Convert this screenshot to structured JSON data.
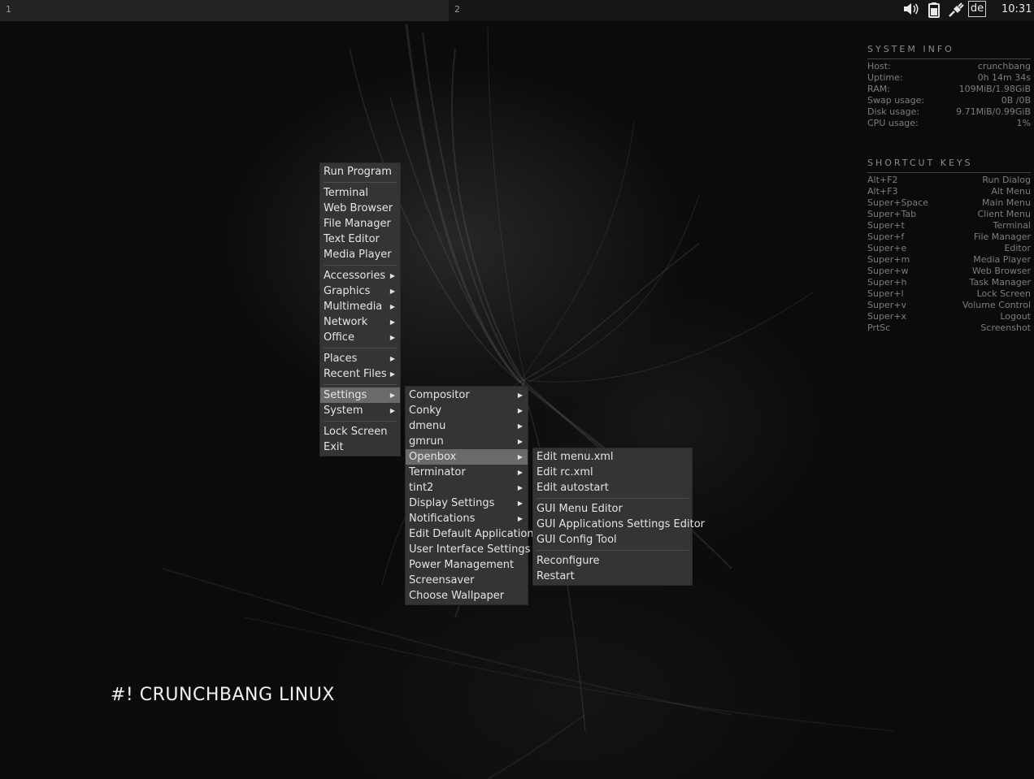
{
  "panel": {
    "workspaces": [
      "1",
      "2"
    ],
    "tray_icons": [
      "volume-icon",
      "battery-icon",
      "power-plug-icon"
    ],
    "keyboard_layout": "de",
    "clock": "10:31"
  },
  "conky": {
    "system_info": {
      "heading": "SYSTEM INFO",
      "rows": [
        {
          "label": "Host:",
          "value": "crunchbang"
        },
        {
          "label": "Uptime:",
          "value": "0h 14m 34s"
        },
        {
          "label": "RAM:",
          "value": "109MiB/1.98GiB"
        },
        {
          "label": "Swap usage:",
          "value": "0B /0B"
        },
        {
          "label": "Disk usage:",
          "value": "9.71MiB/0.99GiB"
        },
        {
          "label": "CPU usage:",
          "value": "1%"
        }
      ]
    },
    "shortcut_keys": {
      "heading": "SHORTCUT KEYS",
      "rows": [
        {
          "label": "Alt+F2",
          "value": "Run Dialog"
        },
        {
          "label": "Alt+F3",
          "value": "Alt Menu"
        },
        {
          "label": "Super+Space",
          "value": "Main Menu"
        },
        {
          "label": "Super+Tab",
          "value": "Client Menu"
        },
        {
          "label": "Super+t",
          "value": "Terminal"
        },
        {
          "label": "Super+f",
          "value": "File Manager"
        },
        {
          "label": "Super+e",
          "value": "Editor"
        },
        {
          "label": "Super+m",
          "value": "Media Player"
        },
        {
          "label": "Super+w",
          "value": "Web Browser"
        },
        {
          "label": "Super+h",
          "value": "Task Manager"
        },
        {
          "label": "Super+l",
          "value": "Lock Screen"
        },
        {
          "label": "Super+v",
          "value": "Volume Control"
        },
        {
          "label": "Super+x",
          "value": "Logout"
        },
        {
          "label": "PrtSc",
          "value": "Screenshot"
        }
      ]
    }
  },
  "main_menu": {
    "items": [
      {
        "label": "Run Program"
      },
      {
        "separator": true
      },
      {
        "label": "Terminal"
      },
      {
        "label": "Web Browser"
      },
      {
        "label": "File Manager"
      },
      {
        "label": "Text Editor"
      },
      {
        "label": "Media Player"
      },
      {
        "separator": true
      },
      {
        "label": "Accessories",
        "submenu": true
      },
      {
        "label": "Graphics",
        "submenu": true
      },
      {
        "label": "Multimedia",
        "submenu": true
      },
      {
        "label": "Network",
        "submenu": true
      },
      {
        "label": "Office",
        "submenu": true
      },
      {
        "separator": true
      },
      {
        "label": "Places",
        "submenu": true
      },
      {
        "label": "Recent Files",
        "submenu": true
      },
      {
        "separator": true
      },
      {
        "label": "Settings",
        "submenu": true,
        "selected": true
      },
      {
        "label": "System",
        "submenu": true
      },
      {
        "separator": true
      },
      {
        "label": "Lock Screen"
      },
      {
        "label": "Exit"
      }
    ]
  },
  "settings_menu": {
    "items": [
      {
        "label": "Compositor",
        "submenu": true
      },
      {
        "label": "Conky",
        "submenu": true
      },
      {
        "label": "dmenu",
        "submenu": true
      },
      {
        "label": "gmrun",
        "submenu": true
      },
      {
        "label": "Openbox",
        "submenu": true,
        "selected": true
      },
      {
        "label": "Terminator",
        "submenu": true
      },
      {
        "label": "tint2",
        "submenu": true
      },
      {
        "label": "Display Settings",
        "submenu": true
      },
      {
        "label": "Notifications",
        "submenu": true
      },
      {
        "label": "Edit Default Applications"
      },
      {
        "label": "User Interface Settings"
      },
      {
        "label": "Power Management"
      },
      {
        "label": "Screensaver"
      },
      {
        "label": "Choose Wallpaper"
      }
    ]
  },
  "openbox_menu": {
    "items": [
      {
        "label": "Edit menu.xml"
      },
      {
        "label": "Edit rc.xml"
      },
      {
        "label": "Edit autostart"
      },
      {
        "separator": true
      },
      {
        "label": "GUI Menu Editor"
      },
      {
        "label": "GUI Applications Settings Editor"
      },
      {
        "label": "GUI Config Tool"
      },
      {
        "separator": true
      },
      {
        "label": "Reconfigure"
      },
      {
        "label": "Restart"
      }
    ]
  },
  "brand": "#! CRUNCHBANG LINUX"
}
